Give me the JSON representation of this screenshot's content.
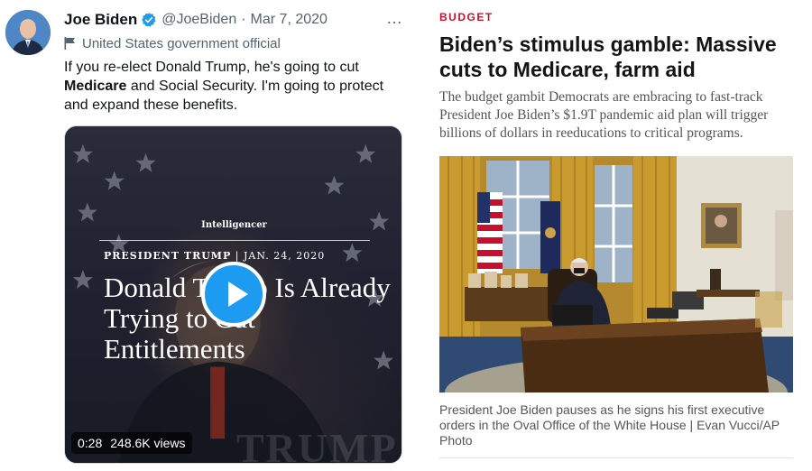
{
  "tweet": {
    "name": "Joe Biden",
    "handle": "@JoeBiden",
    "separator": "·",
    "date": "Mar 7, 2020",
    "account_label": "United States government official",
    "text_part1": "If you re-elect Donald Trump, he's going to cut ",
    "text_bold": "Medicare",
    "text_part2": " and Social Security. I'm going to protect and expand these benefits.",
    "more_icon": "…",
    "icons": [
      "verified-badge-icon",
      "flag-icon",
      "more-icon",
      "play-icon"
    ],
    "video": {
      "masthead": "Intelligencer",
      "kicker_bold": "PRESIDENT TRUMP",
      "kicker_sep": "|",
      "kicker_date": "JAN. 24, 2020",
      "headline": "Donald Trump Is Already Trying to Cut Entitlements",
      "duration": "0:28",
      "views": "248.6K views",
      "watermark": "TRUMP"
    },
    "colors": {
      "accent": "#1d9bf0",
      "muted": "#536471"
    }
  },
  "article": {
    "section": "BUDGET",
    "title": "Biden’s stimulus gamble: Massive cuts to Medicare, farm aid",
    "dek": "The budget gambit Democrats are embracing to fast-track President Joe Biden’s $1.9T pandemic aid plan will trigger billions of dollars in reeducations to critical programs.",
    "caption": "President Joe Biden pauses as he signs his first executive orders in the Oval Office of the White House | Evan Vucci/AP Photo",
    "colors": {
      "section": "#c8102e"
    }
  }
}
